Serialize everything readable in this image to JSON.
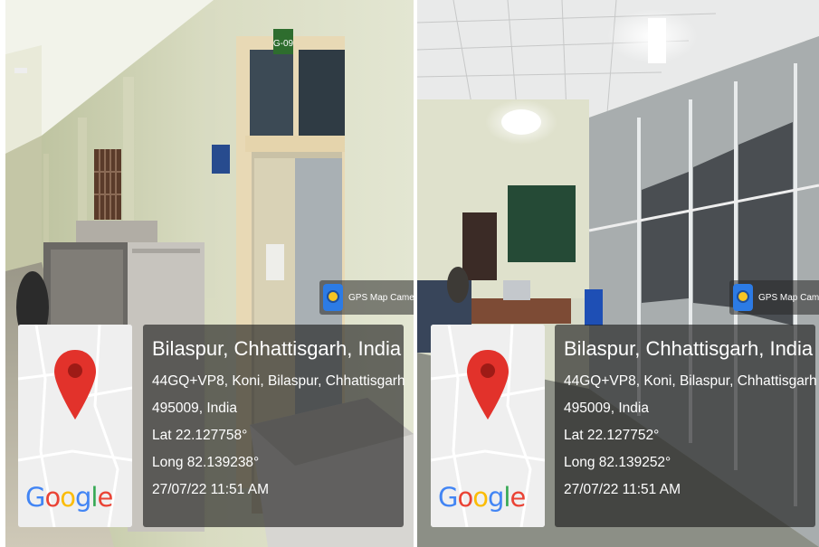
{
  "photos": [
    {
      "badge": {
        "app_name": "GPS Map Camera",
        "icon": "gps-map-camera-icon"
      },
      "sign_text": "G-09",
      "map": {
        "brand": "Google",
        "pin_icon": "location-pin-icon",
        "pin_color": "#e2322b"
      },
      "location": {
        "title": "Bilaspur, Chhattisgarh, India",
        "address": "44GQ+VP8, Koni, Bilaspur, Chhattisgarh",
        "postal": "495009, India",
        "lat": "Lat 22.127758°",
        "long": "Long 82.139238°",
        "datetime": "27/07/22 11:51 AM"
      }
    },
    {
      "badge": {
        "app_name": "GPS Map Camera",
        "icon": "gps-map-camera-icon"
      },
      "map": {
        "brand": "Google",
        "pin_icon": "location-pin-icon",
        "pin_color": "#e2322b"
      },
      "location": {
        "title": "Bilaspur, Chhattisgarh, India",
        "address": "44GQ+VP8, Koni, Bilaspur, Chhattisgarh",
        "postal": "495009, India",
        "lat": "Lat 22.127752°",
        "long": "Long 82.139252°",
        "datetime": "27/07/22 11:51 AM"
      }
    }
  ],
  "colors": {
    "google_blue": "#4285f4",
    "google_red": "#ea4335",
    "google_yellow": "#fbbc05",
    "google_green": "#34a853"
  }
}
